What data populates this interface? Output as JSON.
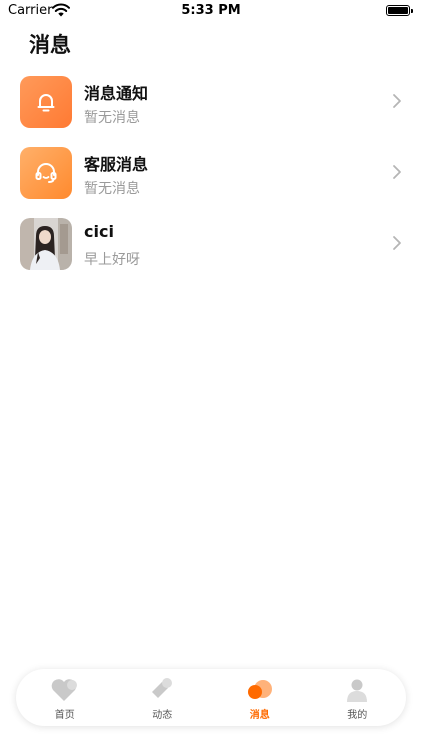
{
  "status_bar": {
    "carrier": "Carrier",
    "time": "5:33 PM"
  },
  "page": {
    "title": "消息"
  },
  "messages": [
    {
      "name": "消息通知",
      "preview": "暂无消息",
      "icon": "bell-icon",
      "color": "#ff8a45"
    },
    {
      "name": "客服消息",
      "preview": "暂无消息",
      "icon": "headset-icon",
      "color": "#ff9a3d"
    },
    {
      "name": "cici",
      "preview": "早上好呀",
      "icon": "user-avatar"
    }
  ],
  "tabs": [
    {
      "label": "首页",
      "icon": "heart-icon",
      "active": false
    },
    {
      "label": "动态",
      "icon": "tag-icon",
      "active": false
    },
    {
      "label": "消息",
      "icon": "message-bubbles-icon",
      "active": true
    },
    {
      "label": "我的",
      "icon": "person-icon",
      "active": false
    }
  ],
  "colors": {
    "accent": "#ff6a00",
    "inactive_icon": "#c8c8c8"
  }
}
